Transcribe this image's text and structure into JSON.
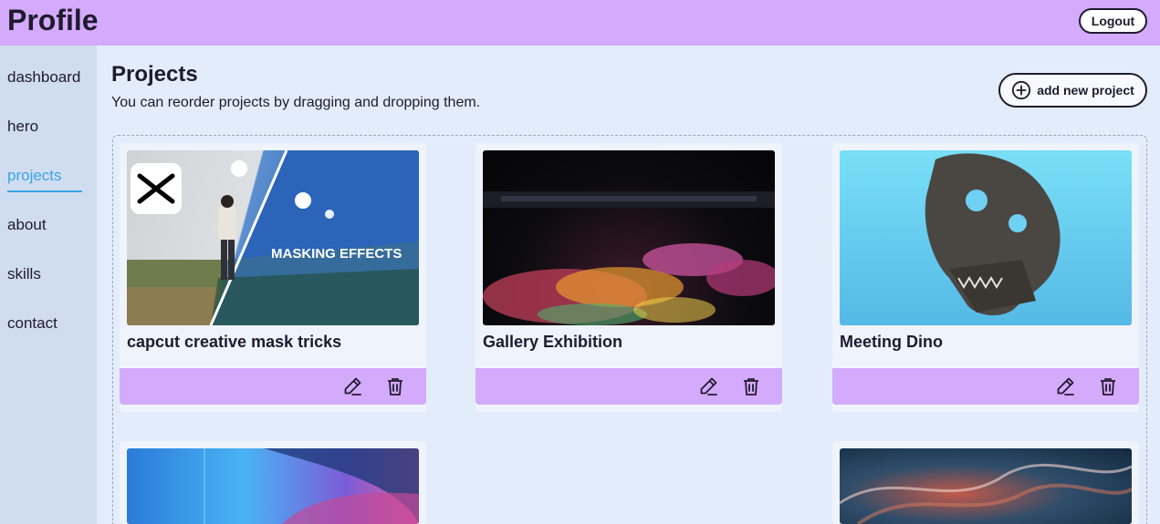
{
  "header": {
    "title": "Profile",
    "logout_label": "Logout"
  },
  "sidebar": {
    "items": [
      {
        "label": "dashboard",
        "active": false
      },
      {
        "label": "hero",
        "active": false
      },
      {
        "label": "projects",
        "active": true
      },
      {
        "label": "about",
        "active": false
      },
      {
        "label": "skills",
        "active": false
      },
      {
        "label": "contact",
        "active": false
      }
    ]
  },
  "main": {
    "title": "Projects",
    "subtitle": "You can reorder projects by dragging and dropping them.",
    "add_button_label": "add new project",
    "projects": [
      {
        "title": "capcut creative mask tricks",
        "image_text": "MASKING EFFECTS"
      },
      {
        "title": "Gallery Exhibition"
      },
      {
        "title": "Meeting Dino"
      },
      {
        "title": ""
      },
      {
        "title": ""
      }
    ]
  },
  "colors": {
    "header_bg": "#d4aafc",
    "sidebar_bg": "#d0ddf0",
    "main_bg": "#e3ecfb",
    "active_link": "#3aa5e8",
    "card_footer": "#d4aafc"
  },
  "icons": [
    "plus-circle-icon",
    "edit-pencil-icon",
    "trash-icon"
  ]
}
